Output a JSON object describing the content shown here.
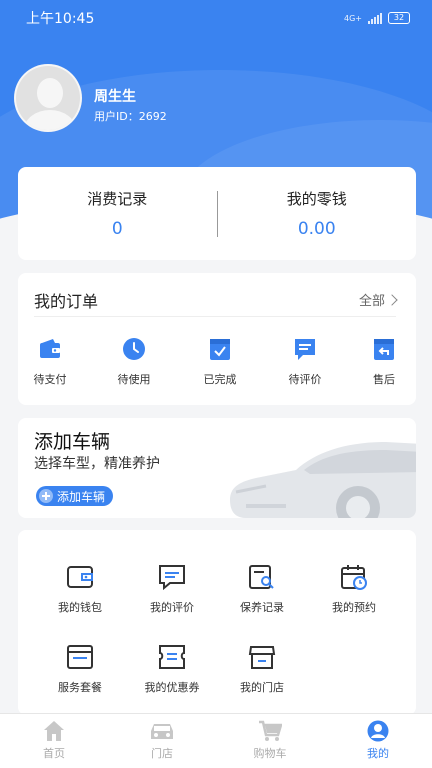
{
  "status_bar": {
    "time": "上午10:45",
    "network": "4G+",
    "battery": "32"
  },
  "profile": {
    "name": "周生生",
    "user_id": "用户ID：2692"
  },
  "balance": {
    "spending_label": "消费记录",
    "spending_value": "0",
    "change_label": "我的零钱",
    "change_value": "0.00"
  },
  "orders": {
    "title": "我的订单",
    "all_label": "全部",
    "items": [
      {
        "label": "待支付",
        "icon": "wallet-icon"
      },
      {
        "label": "待使用",
        "icon": "clock-icon"
      },
      {
        "label": "已完成",
        "icon": "check-box-icon"
      },
      {
        "label": "待评价",
        "icon": "comment-icon"
      },
      {
        "label": "售后",
        "icon": "return-icon"
      }
    ]
  },
  "vehicle": {
    "title": "添加车辆",
    "subtitle": "选择车型，精准养护",
    "button_label": "添加车辆"
  },
  "services": [
    {
      "label": "我的钱包",
      "icon": "wallet-outline-icon"
    },
    {
      "label": "我的评价",
      "icon": "chat-outline-icon"
    },
    {
      "label": "保养记录",
      "icon": "record-search-icon"
    },
    {
      "label": "我的预约",
      "icon": "calendar-clock-icon"
    },
    {
      "label": "服务套餐",
      "icon": "package-icon"
    },
    {
      "label": "我的优惠券",
      "icon": "coupon-icon"
    },
    {
      "label": "我的门店",
      "icon": "store-icon"
    }
  ],
  "tabbar": {
    "items": [
      {
        "label": "首页",
        "icon": "home-icon"
      },
      {
        "label": "门店",
        "icon": "store-car-icon"
      },
      {
        "label": "购物车",
        "icon": "cart-icon"
      },
      {
        "label": "我的",
        "icon": "user-icon"
      }
    ],
    "active": "我的"
  },
  "colors": {
    "accent": "#3a83f0",
    "background": "#f4f5f7",
    "icon_dark": "#333333",
    "inactive": "#aaaaaa"
  }
}
